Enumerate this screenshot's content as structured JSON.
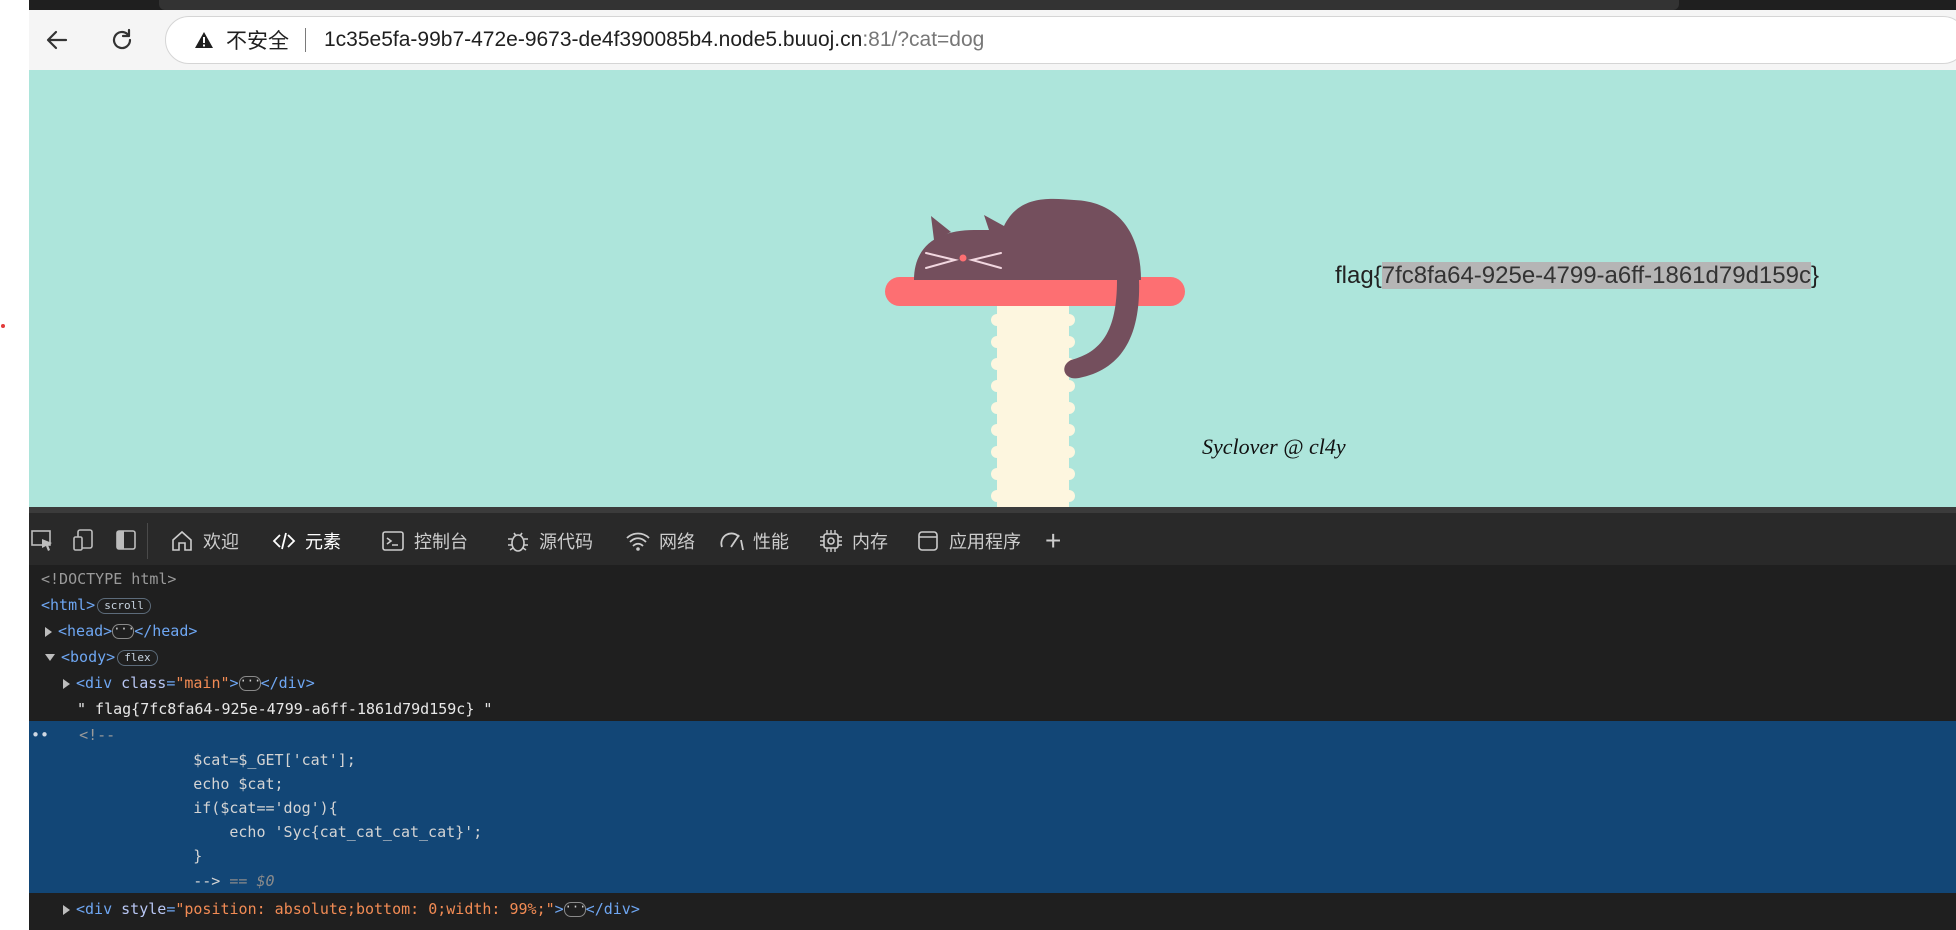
{
  "browser": {
    "security_label": "不安全",
    "url_host": "1c35e5fa-99b7-472e-9673-de4f390085b4.node5.buuoj.cn",
    "url_rest": ":81/?cat=dog"
  },
  "page": {
    "flag_prefix": "flag{",
    "flag_value": "7fc8fa64-925e-4799-a6ff-1861d79d159c",
    "flag_suffix": "}",
    "signature": "Syclover @ cl4y",
    "background_color": "#ade5db"
  },
  "devtools": {
    "tabs": [
      {
        "label": "欢迎",
        "icon": "home-icon"
      },
      {
        "label": "元素",
        "icon": "code-icon"
      },
      {
        "label": "控制台",
        "icon": "console-icon"
      },
      {
        "label": "源代码",
        "icon": "bug-icon"
      },
      {
        "label": "网络",
        "icon": "wifi-icon"
      },
      {
        "label": "性能",
        "icon": "gauge-icon"
      },
      {
        "label": "内存",
        "icon": "chip-icon"
      },
      {
        "label": "应用程序",
        "icon": "app-icon"
      }
    ],
    "add_tab": "+",
    "dom": {
      "doctype": "<!DOCTYPE html>",
      "html_open": "<html>",
      "html_badge": "scroll",
      "head_open": "<head>",
      "head_close": "</head>",
      "body_open": "<body>",
      "body_badge": "flex",
      "div_main_prefix": "<div ",
      "div_main_attr": "class",
      "div_main_eq": "=",
      "div_main_val": "\"main\"",
      "div_main_end": ">",
      "div_close": "</div>",
      "flag_text_node": "\" flag{7fc8fa64-925e-4799-a6ff-1861d79d159c} \"",
      "comment_lines": [
        "<!--",
        "        $cat=$_GET['cat'];",
        "        echo $cat;",
        "        if($cat=='dog'){",
        "            echo 'Syc{cat_cat_cat_cat}';",
        "        }",
        "        -->"
      ],
      "dollar_zero": " == $0",
      "div_style_prefix": "<div ",
      "div_style_attr": "style",
      "div_style_eq": "=",
      "div_style_val": "\"position: absolute;bottom: 0;width: 99%;\"",
      "div_style_end": ">"
    }
  }
}
